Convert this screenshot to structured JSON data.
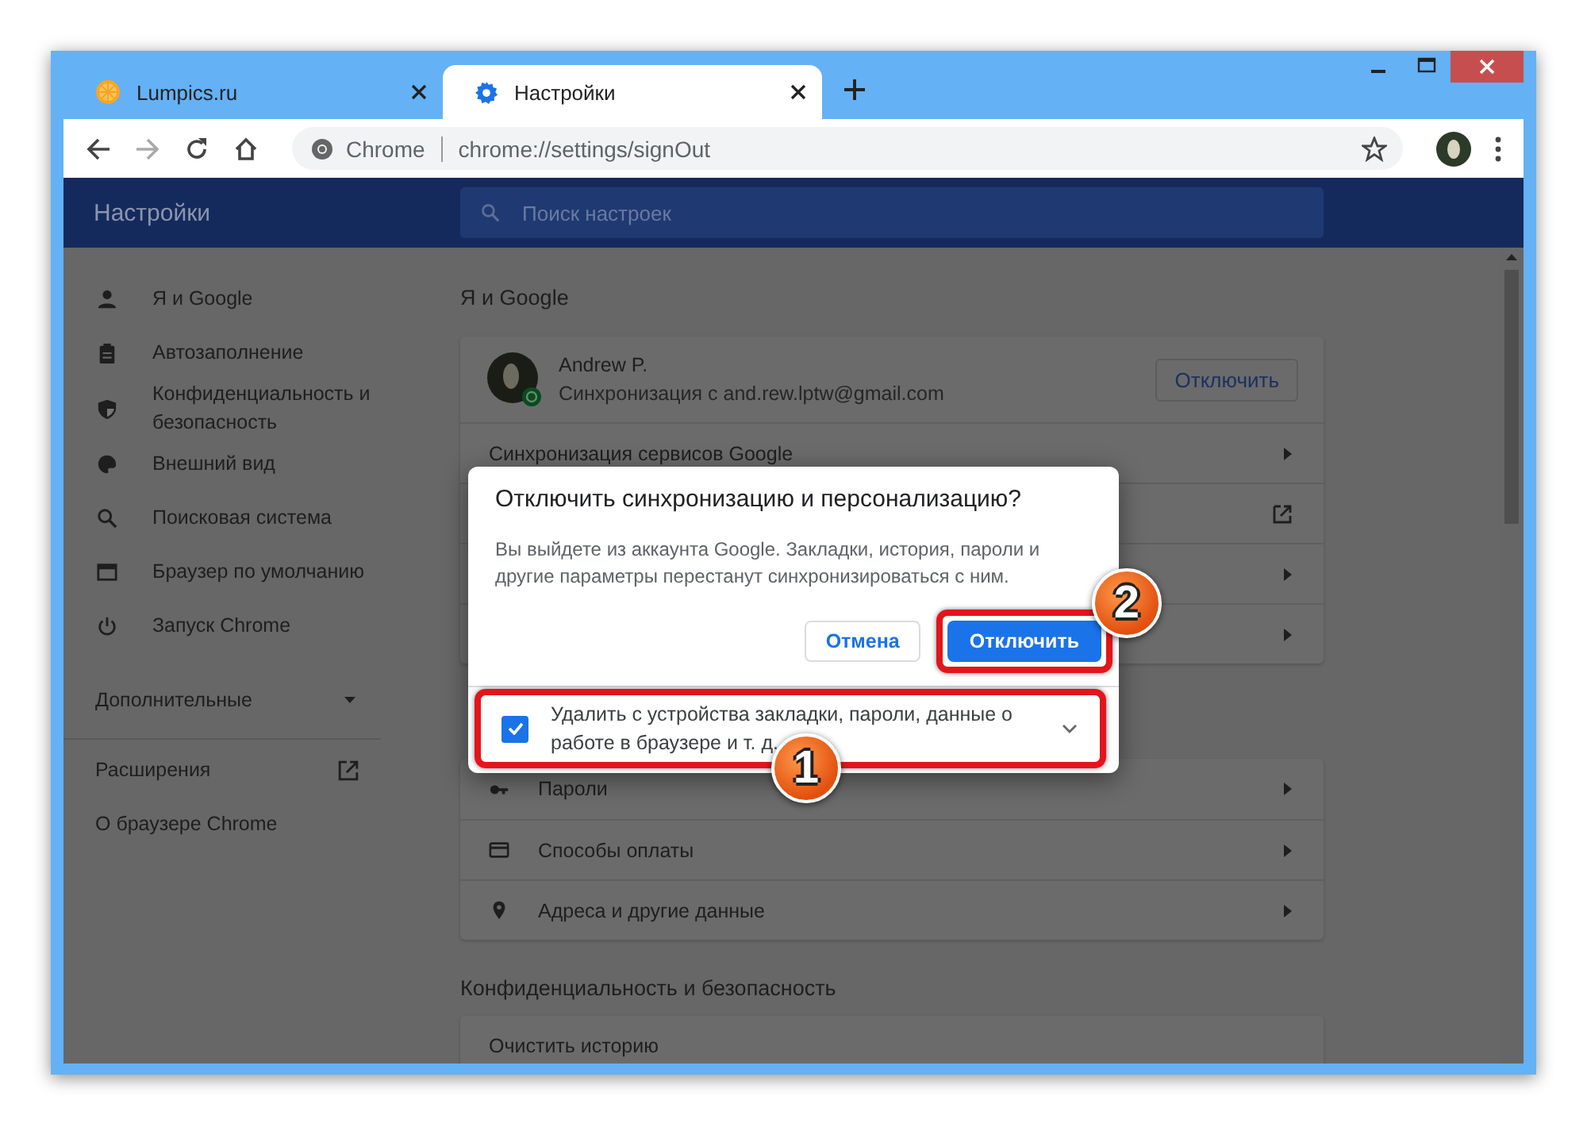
{
  "tabs": [
    {
      "title": "Lumpics.ru",
      "kind": "site",
      "selected": false
    },
    {
      "title": "Настройки",
      "kind": "settings",
      "selected": true
    }
  ],
  "address_bar": {
    "site_label": "Chrome",
    "url": "chrome://settings/signOut"
  },
  "header": {
    "title": "Настройки",
    "search_placeholder": "Поиск настроек"
  },
  "sidebar": {
    "items": [
      {
        "label": "Я и Google",
        "kind": "person"
      },
      {
        "label": "Автозаполнение",
        "kind": "clipboard"
      },
      {
        "label": "Конфиденциальность и безопасность",
        "kind": "shield"
      },
      {
        "label": "Внешний вид",
        "kind": "palette"
      },
      {
        "label": "Поисковая система",
        "kind": "search"
      },
      {
        "label": "Браузер по умолчанию",
        "kind": "browser"
      },
      {
        "label": "Запуск Chrome",
        "kind": "power"
      }
    ],
    "advanced": {
      "label": "Дополнительные",
      "expanded": false
    },
    "links": [
      {
        "label": "Расширения",
        "external": true
      },
      {
        "label": "О браузере Chrome",
        "external": false
      }
    ]
  },
  "sections": [
    {
      "heading": "Я и Google",
      "account": {
        "name": "Andrew P.",
        "sync_text": "Синхронизация с and.rew.lptw@gmail.com",
        "button": "Отключить"
      },
      "rows": [
        {
          "label": "Синхронизация сервисов Google",
          "external": false
        },
        {
          "external": true
        },
        {
          "external": false
        },
        {
          "external": false
        }
      ]
    },
    {
      "rows": [
        {
          "kind": "key",
          "label": "Пароли",
          "external": false
        },
        {
          "kind": "card",
          "label": "Способы оплаты",
          "external": false
        },
        {
          "kind": "pin",
          "label": "Адреса и другие данные",
          "external": false
        }
      ]
    },
    {
      "heading": "Конфиденциальность и безопасность",
      "rows": [
        {
          "label": "Очистить историю"
        }
      ]
    }
  ],
  "dialog": {
    "title": "Отключить синхронизацию и персонализацию?",
    "body": "Вы выйдете из аккаунта Google. Закладки, история, пароли и другие параметры перестанут синхронизироваться с ним.",
    "cancel": "Отмена",
    "confirm": "Отключить",
    "confirm_callout": "2",
    "delete_option": {
      "label": "Удалить с устройства закладки, пароли, данные о работе в браузере и т. д.",
      "checked": true,
      "expanded": false,
      "callout": "1"
    }
  }
}
